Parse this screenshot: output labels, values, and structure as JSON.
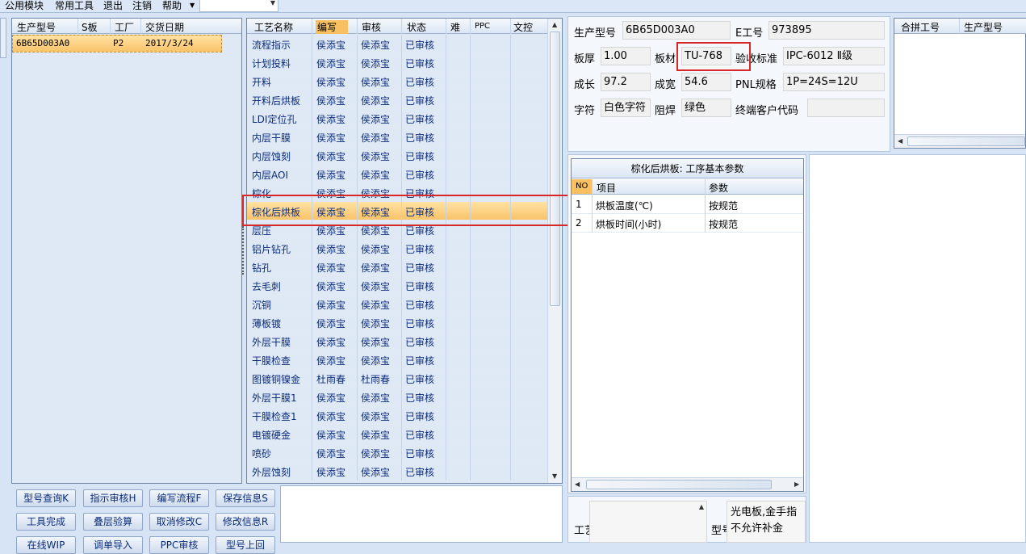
{
  "menu": [
    "公用模块",
    "常用工具",
    "退出",
    "注销",
    "帮助"
  ],
  "left_grid": {
    "headers": [
      "生产型号",
      "S板",
      "工厂",
      "交货日期"
    ],
    "rows": [
      [
        "6B65D003A0",
        "",
        "P2",
        "2017/3/24"
      ]
    ]
  },
  "process_grid": {
    "headers": [
      "工艺名称",
      "编写",
      "审核",
      "状态",
      "难",
      "PPC",
      "文控"
    ],
    "rows": [
      [
        "流程指示",
        "侯添宝",
        "侯添宝",
        "已审核"
      ],
      [
        "计划投料",
        "侯添宝",
        "侯添宝",
        "已审核"
      ],
      [
        "开料",
        "侯添宝",
        "侯添宝",
        "已审核"
      ],
      [
        "开料后烘板",
        "侯添宝",
        "侯添宝",
        "已审核"
      ],
      [
        "LDI定位孔",
        "侯添宝",
        "侯添宝",
        "已审核"
      ],
      [
        "内层干膜",
        "侯添宝",
        "侯添宝",
        "已审核"
      ],
      [
        "内层蚀刻",
        "侯添宝",
        "侯添宝",
        "已审核"
      ],
      [
        "内层AOI",
        "侯添宝",
        "侯添宝",
        "已审核"
      ],
      [
        "棕化",
        "侯添宝",
        "侯添宝",
        "已审核"
      ],
      [
        "棕化后烘板",
        "侯添宝",
        "侯添宝",
        "已审核"
      ],
      [
        "层压",
        "侯添宝",
        "侯添宝",
        "已审核"
      ],
      [
        "铝片钻孔",
        "侯添宝",
        "侯添宝",
        "已审核"
      ],
      [
        "钻孔",
        "侯添宝",
        "侯添宝",
        "已审核"
      ],
      [
        "去毛刺",
        "侯添宝",
        "侯添宝",
        "已审核"
      ],
      [
        "沉铜",
        "侯添宝",
        "侯添宝",
        "已审核"
      ],
      [
        "薄板镀",
        "侯添宝",
        "侯添宝",
        "已审核"
      ],
      [
        "外层干膜",
        "侯添宝",
        "侯添宝",
        "已审核"
      ],
      [
        "干膜检查",
        "侯添宝",
        "侯添宝",
        "已审核"
      ],
      [
        "图镀铜镍金",
        "杜雨春",
        "杜雨春",
        "已审核"
      ],
      [
        "外层干膜1",
        "侯添宝",
        "侯添宝",
        "已审核"
      ],
      [
        "干膜检查1",
        "侯添宝",
        "侯添宝",
        "已审核"
      ],
      [
        "电镀硬金",
        "侯添宝",
        "侯添宝",
        "已审核"
      ],
      [
        "喷砂",
        "侯添宝",
        "侯添宝",
        "已审核"
      ],
      [
        "外层蚀刻",
        "侯添宝",
        "侯添宝",
        "已审核"
      ]
    ]
  },
  "buttons": {
    "row1": [
      "型号查询K",
      "指示审核H",
      "编写流程F",
      "保存信息S"
    ],
    "row2": [
      "工具完成",
      "叠层验算",
      "取消修改C",
      "修改信息R"
    ],
    "row3": [
      "在线WIP",
      "调单导入",
      "PPC审核",
      "型号上回"
    ]
  },
  "info": {
    "model_label": "生产型号",
    "model": "6B65D003A0",
    "eno_label": "E工号",
    "eno": "973895",
    "thick_label": "板厚",
    "thick": "1.00",
    "material_label": "板材",
    "material": "TU-768",
    "std_label": "验收标准",
    "std": "IPC-6012 Ⅱ级",
    "len_label": "成长",
    "len": "97.2",
    "wid_label": "成宽",
    "wid": "54.6",
    "pnl_label": "PNL规格",
    "pnl": "1P=24S=12U",
    "char_label": "字符",
    "char": "白色字符",
    "mask_label": "阻焊",
    "mask": "绿色",
    "cust_label": "终端客户代码",
    "cust": ""
  },
  "merge_grid": {
    "headers": [
      "合拼工号",
      "生产型号"
    ]
  },
  "params": {
    "title": "棕化后烘板: 工序基本参数",
    "headers": [
      "NO",
      "项目",
      "参数"
    ],
    "rows": [
      [
        "1",
        "烘板温度(℃)",
        "按规范"
      ],
      [
        "2",
        "烘板时间(小时)",
        "按规范"
      ]
    ]
  },
  "bottom": {
    "label1": "工艺",
    "label2": "型号",
    "note": "光电板,金手指不允许补金"
  }
}
